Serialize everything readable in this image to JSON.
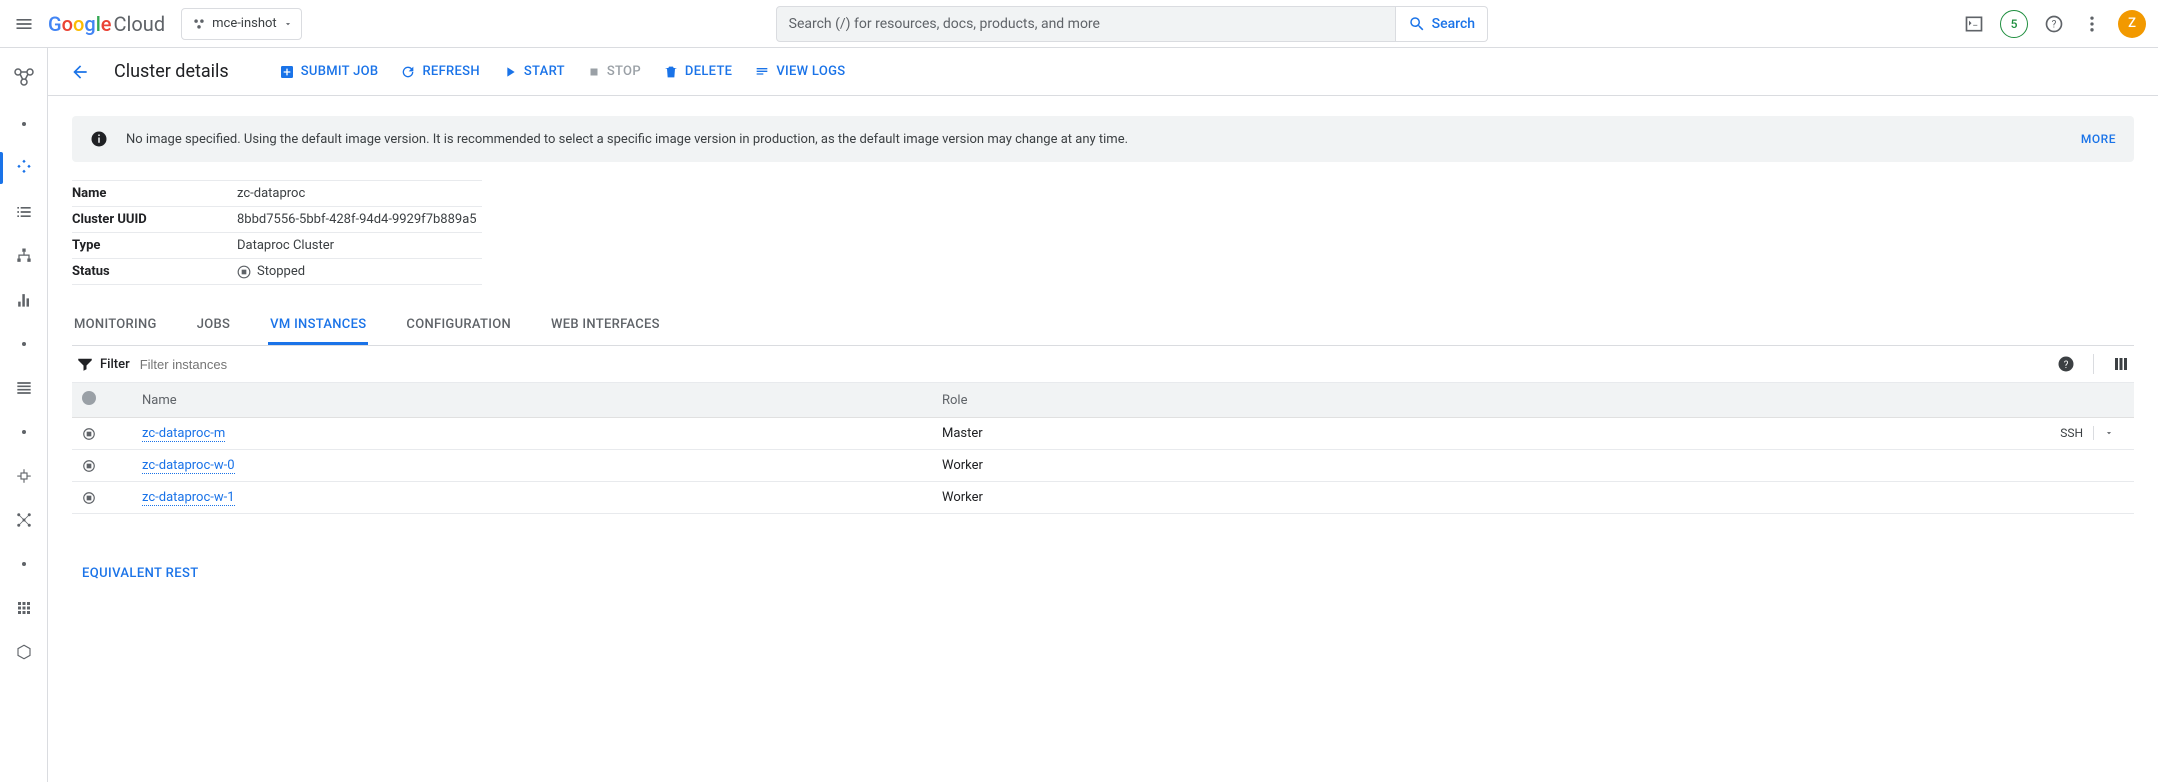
{
  "topbar": {
    "logo_google": "Google",
    "logo_cloud": "Cloud",
    "project_name": "mce-inshot",
    "search_placeholder": "Search (/) for resources, docs, products, and more",
    "search_button": "Search",
    "trial_credits": "5",
    "avatar_initial": "Z"
  },
  "actionbar": {
    "title": "Cluster details",
    "submit_job": "SUBMIT JOB",
    "refresh": "REFRESH",
    "start": "START",
    "stop": "STOP",
    "delete": "DELETE",
    "view_logs": "VIEW LOGS"
  },
  "banner": {
    "text": "No image specified. Using the default image version. It is recommended to select a specific image version in production, as the default image version may change at any time.",
    "more": "MORE"
  },
  "details": {
    "name_label": "Name",
    "name_value": "zc-dataproc",
    "uuid_label": "Cluster UUID",
    "uuid_value": "8bbd7556-5bbf-428f-94d4-9929f7b889a5",
    "type_label": "Type",
    "type_value": "Dataproc Cluster",
    "status_label": "Status",
    "status_value": "Stopped"
  },
  "tabs": {
    "monitoring": "MONITORING",
    "jobs": "JOBS",
    "vm_instances": "VM INSTANCES",
    "configuration": "CONFIGURATION",
    "web_interfaces": "WEB INTERFACES"
  },
  "filter": {
    "label": "Filter",
    "placeholder": "Filter instances"
  },
  "table": {
    "col_name": "Name",
    "col_role": "Role",
    "ssh_label": "SSH",
    "rows": [
      {
        "name": "zc-dataproc-m",
        "role": "Master",
        "ssh": true
      },
      {
        "name": "zc-dataproc-w-0",
        "role": "Worker",
        "ssh": false
      },
      {
        "name": "zc-dataproc-w-1",
        "role": "Worker",
        "ssh": false
      }
    ]
  },
  "equivalent_rest": "EQUIVALENT REST"
}
